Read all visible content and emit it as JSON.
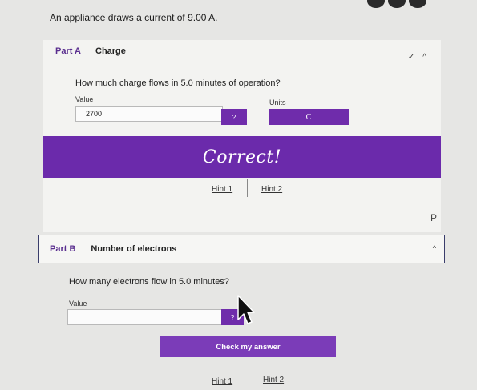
{
  "problem": {
    "statement": "An appliance draws a current of 9.00 A."
  },
  "part_a": {
    "label": "Part A",
    "title": "Charge",
    "question": "How much charge flows in 5.0 minutes of operation?",
    "value_label": "Value",
    "value": "2700",
    "help_label": "?",
    "units_label": "Units",
    "units_value": "C",
    "feedback": "Correct!",
    "hint1": "Hint 1",
    "hint2": "Hint 2",
    "status_icon": "check-icon",
    "collapse_icon": "chevron-up-icon"
  },
  "side_glyph": "P",
  "part_b": {
    "label": "Part B",
    "title": "Number of electrons",
    "question": "How many electrons flow in 5.0 minutes?",
    "value_label": "Value",
    "value": "",
    "help_label": "?",
    "check_label": "Check my answer",
    "hint1": "Hint 1",
    "hint2": "Hint 2"
  },
  "colors": {
    "accent": "#6b2aab",
    "brand_text": "#5a2e8f",
    "border": "#3a3d6b"
  }
}
